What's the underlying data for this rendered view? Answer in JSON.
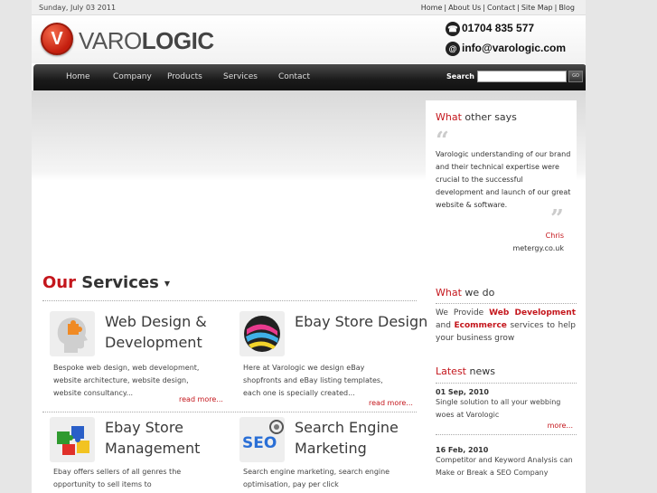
{
  "topbar": {
    "date": "Sunday, July 03 2011",
    "links": [
      "Home",
      "About Us",
      "Contact",
      "Site Map",
      "Blog"
    ]
  },
  "logo": {
    "mark": "V",
    "text_light": "VARO",
    "text_bold": "LOGIC"
  },
  "contact": {
    "phone": "01704 835 577",
    "email": "info@varologic.com",
    "phone_icon": "phone-icon",
    "email_icon": "at-icon"
  },
  "nav": {
    "items": [
      "Home",
      "Company",
      "Products",
      "Services",
      "Contact"
    ],
    "search_label": "Search",
    "search_value": "",
    "go_label": "GO"
  },
  "testimonial": {
    "heading_red": "What",
    "heading_rest": " other says",
    "text": "Varologic understanding of our brand and their technical expertise were crucial to the successful development and launch of our great website & software.",
    "author": "Chris",
    "site": "metergy.co.uk"
  },
  "services": {
    "heading_red": "Our",
    "heading_rest": " Services",
    "items": [
      {
        "title": "Web Design & Development",
        "desc": "Bespoke web design, web development, website architecture, website design, website consultancy...",
        "more": "read more..."
      },
      {
        "title": "Ebay Store Design",
        "desc": "Here at Varologic we design eBay shopfronts and eBay listing templates, each one is specially created...",
        "more": "read more..."
      },
      {
        "title": "Ebay Store Management",
        "desc": "Ebay offers sellers of all genres the opportunity to sell items to"
      },
      {
        "title": "Search Engine Marketing",
        "desc": "Search engine marketing, search engine optimisation, pay per click"
      }
    ]
  },
  "whatwedo": {
    "heading_red": "What",
    "heading_rest": " we do",
    "p1": "We Provide ",
    "b1": "Web Development",
    "p2": " and ",
    "b2": "Ecommerce",
    "p3": " services to help your business grow"
  },
  "latest": {
    "heading_red": "Latest",
    "heading_rest": " news",
    "items": [
      {
        "date": "01 Sep, 2010",
        "text": "Single solution to all your webbing woes at Varologic",
        "more": "more..."
      },
      {
        "date": "16 Feb, 2010",
        "text": "Competitor and Keyword Analysis can Make or Break a SEO Company"
      }
    ]
  },
  "colors": {
    "accent": "#c4161c",
    "nav_bg": "#1a1a1a",
    "page_bg": "#e6e6e6"
  }
}
